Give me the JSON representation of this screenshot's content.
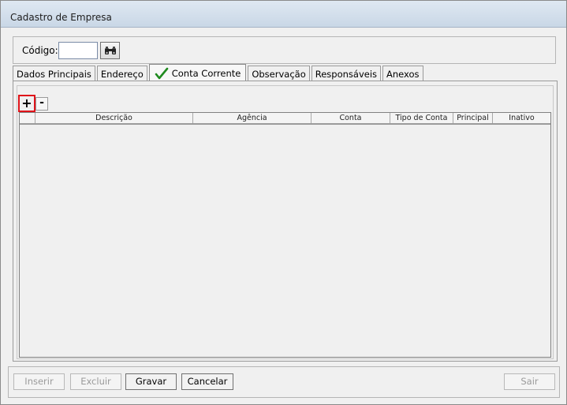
{
  "window": {
    "title": "Cadastro de Empresa"
  },
  "code": {
    "label": "Código:",
    "value": ""
  },
  "tabs": [
    {
      "label": "Dados Principais"
    },
    {
      "label": "Endereço"
    },
    {
      "label": "Conta Corrente",
      "active": true,
      "icon": "check-icon"
    },
    {
      "label": "Observação"
    },
    {
      "label": "Responsáveis"
    },
    {
      "label": "Anexos"
    }
  ],
  "grid": {
    "add_label": "+",
    "remove_label": "-",
    "columns": [
      "Descrição",
      "Agência",
      "Conta",
      "Tipo de Conta",
      "Principal",
      "Inativo"
    ],
    "rows": []
  },
  "buttons": {
    "inserir": "Inserir",
    "excluir": "Excluir",
    "gravar": "Gravar",
    "cancelar": "Cancelar",
    "sair": "Sair"
  },
  "colors": {
    "accent_check": "#1e8a1e",
    "highlight_border": "#e0141a"
  }
}
